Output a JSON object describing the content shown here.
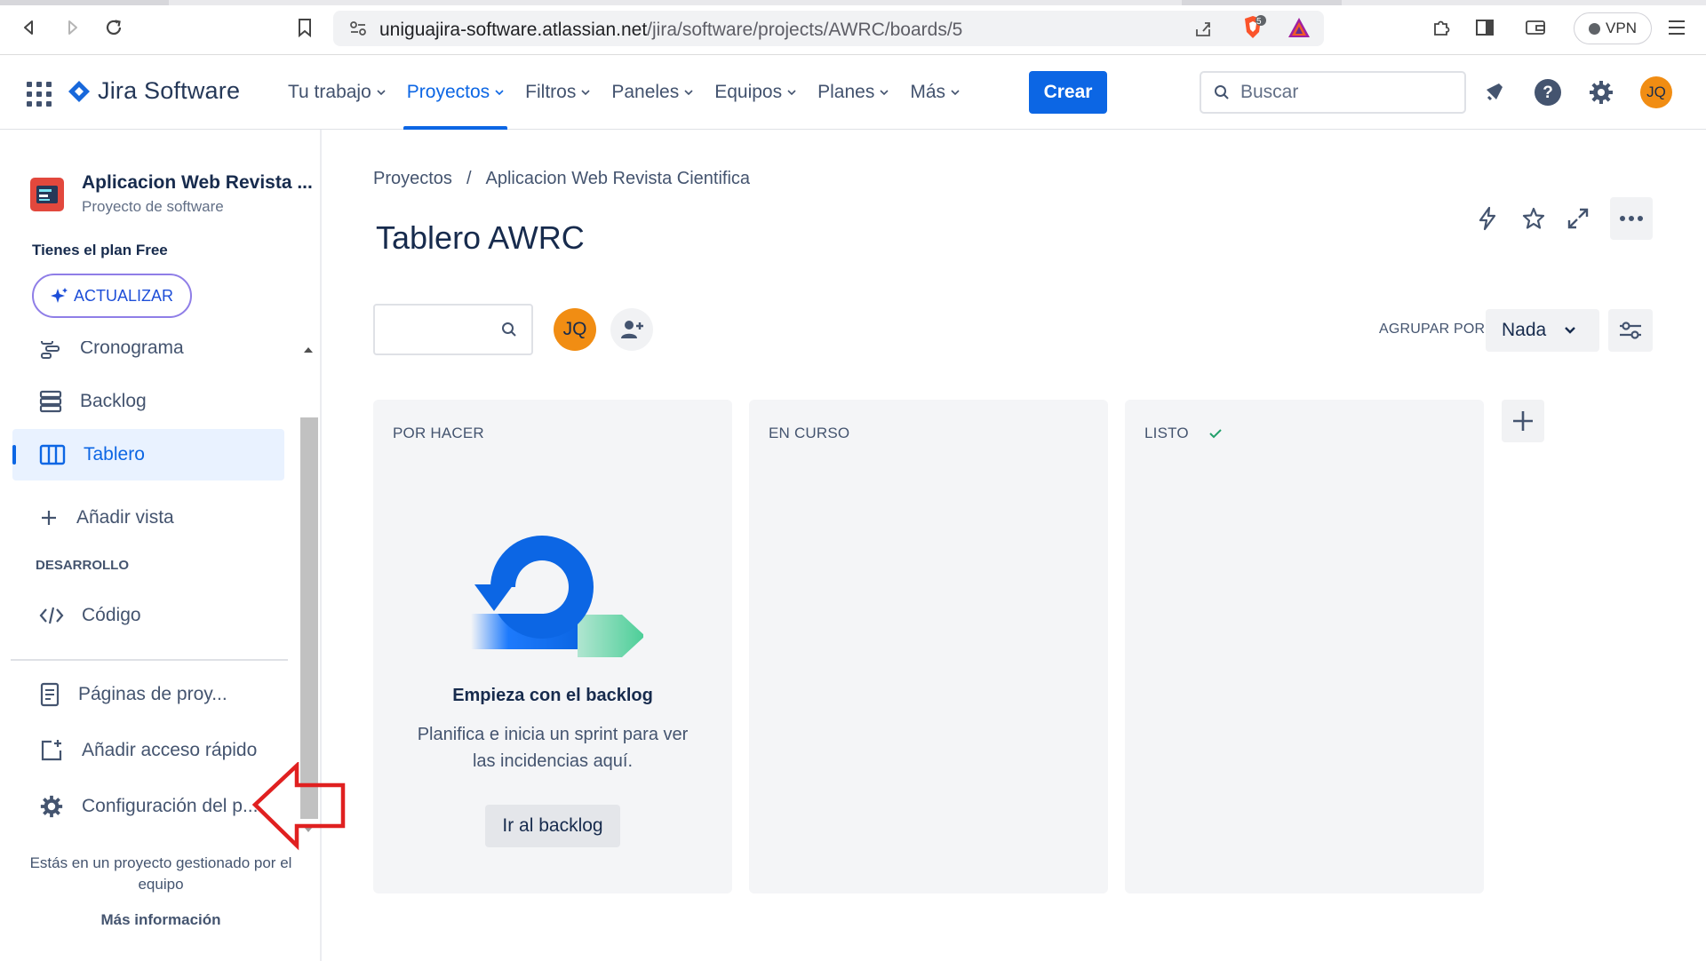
{
  "browser": {
    "url_host": "uniguajira-software.atlassian.net",
    "url_path": "/jira/software/projects/AWRC/boards/5",
    "shield_badge": "5",
    "vpn_label": "VPN"
  },
  "topnav": {
    "product_name": "Jira Software",
    "items": [
      {
        "label": "Tu trabajo"
      },
      {
        "label": "Proyectos",
        "active": true
      },
      {
        "label": "Filtros"
      },
      {
        "label": "Paneles"
      },
      {
        "label": "Equipos"
      },
      {
        "label": "Planes"
      },
      {
        "label": "Más"
      }
    ],
    "create_label": "Crear",
    "search_placeholder": "Buscar",
    "avatar_initials": "JQ"
  },
  "sidebar": {
    "project_name": "Aplicacion Web Revista ...",
    "project_type": "Proyecto de software",
    "plan_text": "Tienes el plan Free",
    "upgrade_label": "ACTUALIZAR",
    "items": {
      "cronograma": "Cronograma",
      "backlog": "Backlog",
      "tablero": "Tablero",
      "add_view": "Añadir vista",
      "dev_section": "DESARROLLO",
      "codigo": "Código",
      "pages": "Páginas de proy...",
      "shortcut": "Añadir acceso rápido",
      "settings": "Configuración del p..."
    },
    "footer_text": "Estás en un proyecto gestionado por el equipo",
    "footer_link": "Más información"
  },
  "main": {
    "breadcrumb": {
      "root": "Proyectos",
      "separator": "/",
      "project": "Aplicacion Web Revista Cientifica"
    },
    "title": "Tablero AWRC",
    "avatar_initials": "JQ",
    "group_by_label": "AGRUPAR POR",
    "group_by_value": "Nada",
    "columns": [
      {
        "title": "POR HACER"
      },
      {
        "title": "EN CURSO"
      },
      {
        "title": "LISTO"
      }
    ],
    "empty_state": {
      "title": "Empieza con el backlog",
      "description": "Planifica e inicia un sprint para ver las incidencias aquí.",
      "button": "Ir al backlog"
    }
  },
  "colors": {
    "accent": "#0c66e4",
    "avatar": "#f18d13",
    "annotation_arrow": "#e02020",
    "done_check": "#22a06b"
  }
}
